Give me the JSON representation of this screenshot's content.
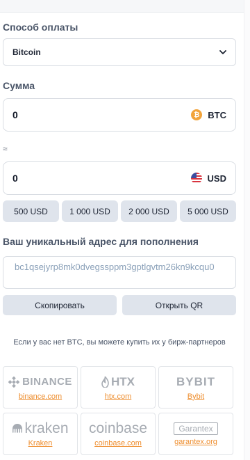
{
  "payment": {
    "method_label": "Способ оплаты",
    "selected_method": "Bitcoin"
  },
  "amount": {
    "label": "Сумма",
    "crypto_value": "0",
    "crypto_currency": "BTC",
    "approx_symbol": "≈",
    "fiat_value": "0",
    "fiat_currency": "USD"
  },
  "presets": [
    "500 USD",
    "1 000 USD",
    "2 000 USD",
    "5 000 USD"
  ],
  "address": {
    "label": "Ваш уникальный адрес для пополнения",
    "value": "bc1qsejyrp8mk0dvegssppm3gptlgvtm26kn9kcqu0"
  },
  "actions": {
    "copy_label": "Скопировать",
    "qr_label": "Открыть QR"
  },
  "exchanges": {
    "hint": "Если у вас нет BTC, вы можете купить их у бирж-партнеров",
    "items": [
      {
        "logo_text": "BINANCE",
        "link": "binance.com"
      },
      {
        "logo_text": "HTX",
        "link": "htx.com"
      },
      {
        "logo_text": "BYBIT",
        "link": "Bybit"
      },
      {
        "logo_text": "kraken",
        "link": "Kraken"
      },
      {
        "logo_text": "coinbase",
        "link": "coinbase.com"
      },
      {
        "logo_text": "Garantex",
        "link": "garantex.org"
      }
    ]
  },
  "colors": {
    "accent_link": "#ee8d2d",
    "bitcoin": "#f2a43b",
    "button_bg": "#dfe4ec",
    "address_text": "#8ba1b9"
  }
}
